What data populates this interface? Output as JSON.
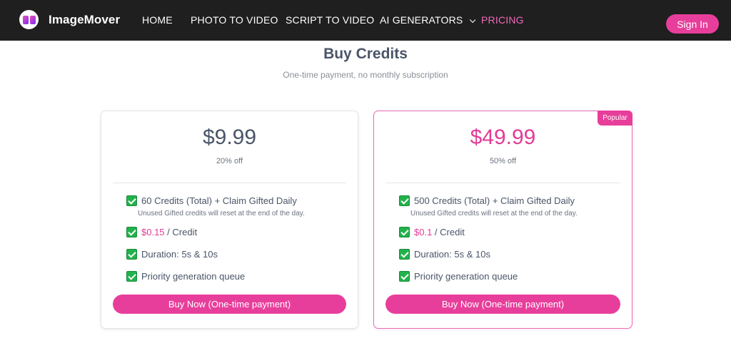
{
  "nav": {
    "brand": "ImageMover",
    "links": [
      {
        "label": "HOME"
      },
      {
        "label": "PHOTO TO VIDEO"
      },
      {
        "label": "SCRIPT TO VIDEO"
      },
      {
        "label": "AI GENERATORS"
      },
      {
        "label": "PRICING"
      }
    ],
    "signin": "Sign In"
  },
  "header": {
    "title": "Buy Credits",
    "subtitle": "One-time payment, no monthly subscription"
  },
  "plans": [
    {
      "price": "$9.99",
      "discount": "20% off",
      "credits": "60 Credits (Total) + Claim Gifted Daily",
      "note": "Unused Gifted credits will reset at the end of the day.",
      "per_credit": "$0.15",
      "per_credit_suffix": " / Credit",
      "duration": "Duration: 5s & 10s",
      "queue": "Priority generation queue",
      "button": "Buy Now (One-time payment)"
    },
    {
      "badge": "Popular",
      "price": "$49.99",
      "discount": "50% off",
      "credits": "500 Credits (Total) + Claim Gifted Daily",
      "note": "Unused Gifted credits will reset at the end of the day.",
      "per_credit": "$0.1",
      "per_credit_suffix": " / Credit",
      "duration": "Duration: 5s & 10s",
      "queue": "Priority generation queue",
      "button": "Buy Now (One-time payment)"
    }
  ],
  "colors": {
    "accent": "#e83e9b",
    "nav_bg": "#1f1f1f",
    "check": "#22b24c"
  },
  "icons": {
    "logo": "imagemover-logo-icon",
    "dropdown": "chevron-down-icon",
    "feature": "check-box-icon"
  }
}
